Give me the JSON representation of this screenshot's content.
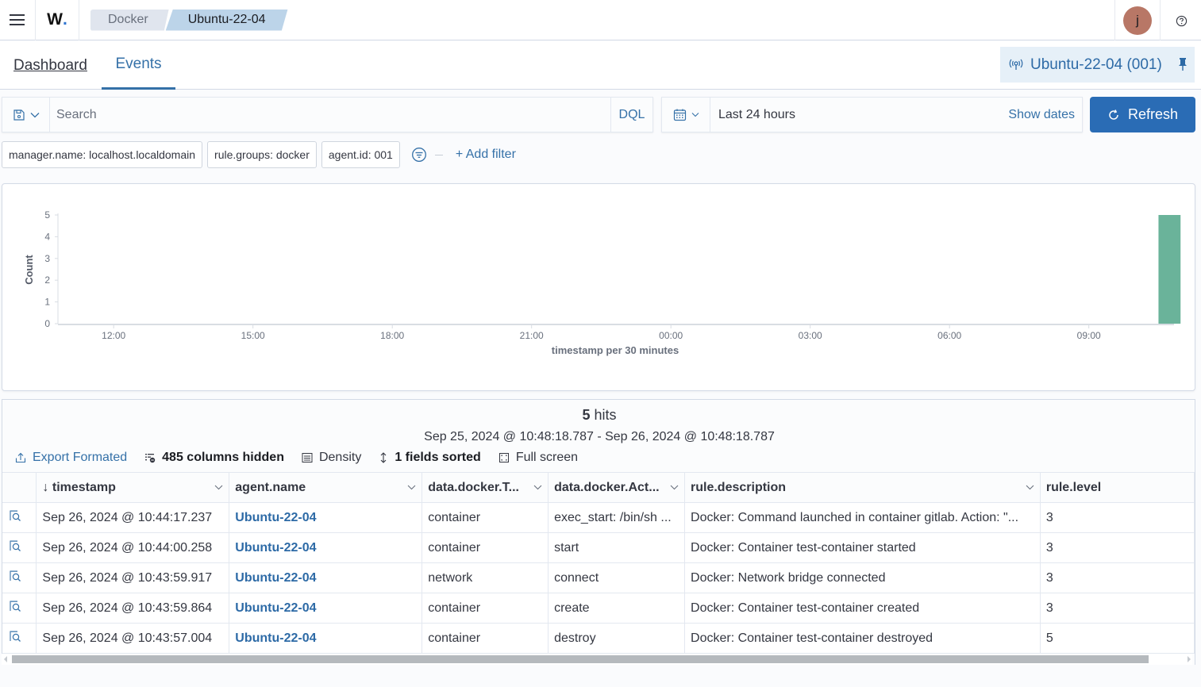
{
  "header": {
    "logo_text": "W",
    "breadcrumbs": [
      "Docker",
      "Ubuntu-22-04"
    ],
    "avatar_initial": "j",
    "icons": {
      "menu": "hamburger-icon",
      "help": "help-circle-icon"
    }
  },
  "tabs": [
    {
      "label": "Dashboard",
      "active": false
    },
    {
      "label": "Events",
      "active": true
    }
  ],
  "agent_selector": {
    "label": "Ubuntu-22-04 (001)",
    "icon": "antenna-icon",
    "pin_icon": "pin-icon"
  },
  "query": {
    "placeholder": "Search",
    "value": "",
    "language": "DQL",
    "save_icon": "save-icon"
  },
  "date_picker": {
    "range": "Last 24 hours",
    "show_dates": "Show dates",
    "calendar_icon": "calendar-icon"
  },
  "refresh": {
    "label": "Refresh",
    "icon": "refresh-icon",
    "color": "#2a6cb5"
  },
  "filters": {
    "pills": [
      "manager.name: localhost.localdomain",
      "rule.groups: docker",
      "agent.id: 001"
    ],
    "add_filter": "+ Add filter"
  },
  "chart_data": {
    "type": "bar",
    "title": "",
    "xlabel": "timestamp per 30 minutes",
    "ylabel": "Count",
    "ylim": [
      0,
      5
    ],
    "yticks": [
      "0",
      "1",
      "2",
      "3",
      "4",
      "5"
    ],
    "xticks": [
      "12:00",
      "15:00",
      "18:00",
      "21:00",
      "00:00",
      "03:00",
      "06:00",
      "09:00"
    ],
    "x_range_hours": [
      10.8,
      34.8
    ],
    "bars": [
      {
        "x": "10:30",
        "x_hours": 34.5,
        "value": 5
      }
    ],
    "bar_color": "#6ab39a",
    "grid": false
  },
  "results": {
    "hits_count": "5",
    "hits_label": "hits",
    "range": "Sep 25, 2024 @ 10:48:18.787 - Sep 26, 2024 @ 10:48:18.787",
    "toolbar": {
      "export": "Export Formated",
      "columns_hidden": "485 columns hidden",
      "density": "Density",
      "sorted": "1 fields sorted",
      "fullscreen": "Full screen"
    },
    "columns": [
      "timestamp",
      "agent.name",
      "data.docker.T...",
      "data.docker.Act...",
      "rule.description",
      "rule.level"
    ],
    "rows": [
      {
        "timestamp": "Sep 26, 2024 @ 10:44:17.237",
        "agent": "Ubuntu-22-04",
        "type": "container",
        "action": "exec_start: /bin/sh ...",
        "description": "Docker: Command launched in container gitlab. Action: \"...",
        "level": "3"
      },
      {
        "timestamp": "Sep 26, 2024 @ 10:44:00.258",
        "agent": "Ubuntu-22-04",
        "type": "container",
        "action": "start",
        "description": "Docker: Container test-container started",
        "level": "3"
      },
      {
        "timestamp": "Sep 26, 2024 @ 10:43:59.917",
        "agent": "Ubuntu-22-04",
        "type": "network",
        "action": "connect",
        "description": "Docker: Network bridge connected",
        "level": "3"
      },
      {
        "timestamp": "Sep 26, 2024 @ 10:43:59.864",
        "agent": "Ubuntu-22-04",
        "type": "container",
        "action": "create",
        "description": "Docker: Container test-container created",
        "level": "3"
      },
      {
        "timestamp": "Sep 26, 2024 @ 10:43:57.004",
        "agent": "Ubuntu-22-04",
        "type": "container",
        "action": "destroy",
        "description": "Docker: Container test-container destroyed",
        "level": "5"
      }
    ]
  }
}
